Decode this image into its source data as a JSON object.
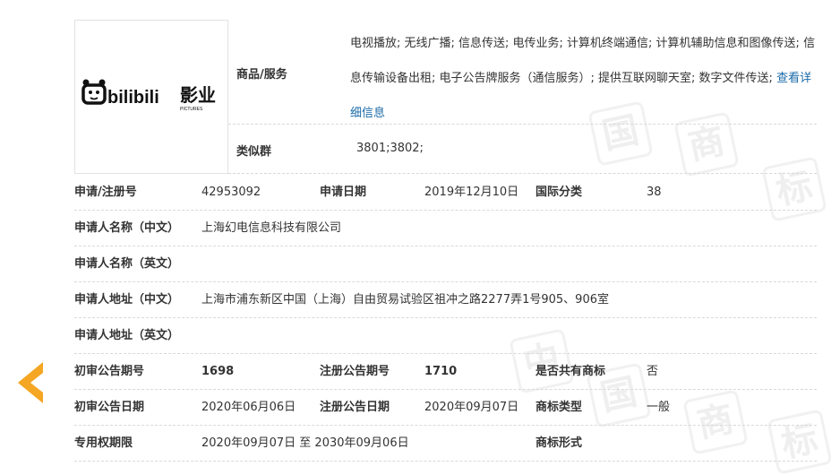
{
  "watermark_glyphs": [
    "中",
    "国",
    "商",
    "标"
  ],
  "logo": {
    "brand": "bilibili",
    "sub": "影业",
    "caption": "PICTURES"
  },
  "goods": {
    "label": "商品/服务",
    "text": "电视播放; 无线广播; 信息传送; 电传业务; 计算机终端通信; 计算机辅助信息和图像传送; 信息传输设备出租; 电子公告牌服务（通信服务）; 提供互联网聊天室; 数字文件传送;",
    "link": "查看详细信息"
  },
  "similar": {
    "label": "类似群",
    "value": "3801;3802;"
  },
  "rows": {
    "reg_no_label": "申请/注册号",
    "reg_no": "42953092",
    "apply_date_label": "申请日期",
    "apply_date": "2019年12月10日",
    "intl_class_label": "国际分类",
    "intl_class": "38",
    "applicant_cn_label": "申请人名称（中文）",
    "applicant_cn": "上海幻电信息科技有限公司",
    "applicant_en_label": "申请人名称（英文）",
    "applicant_en": "",
    "address_cn_label": "申请人地址（中文）",
    "address_cn": "上海市浦东新区中国（上海）自由贸易试验区祖冲之路2277弄1号905、906室",
    "address_en_label": "申请人地址（英文）",
    "address_en": "",
    "prelim_no_label": "初审公告期号",
    "prelim_no": "1698",
    "reg_pub_no_label": "注册公告期号",
    "reg_pub_no": "1710",
    "shared_label": "是否共有商标",
    "shared": "否",
    "prelim_date_label": "初审公告日期",
    "prelim_date": "2020年06月06日",
    "reg_pub_date_label": "注册公告日期",
    "reg_pub_date": "2020年09月07日",
    "tm_type_label": "商标类型",
    "tm_type": "一般",
    "exclusive_label": "专用权期限",
    "exclusive": "2020年09月07日 至 2030年09月06日",
    "tm_form_label": "商标形式",
    "tm_form": ""
  },
  "colors": {
    "accent_arrow": "#f5a623",
    "link": "#1a6aa8"
  }
}
